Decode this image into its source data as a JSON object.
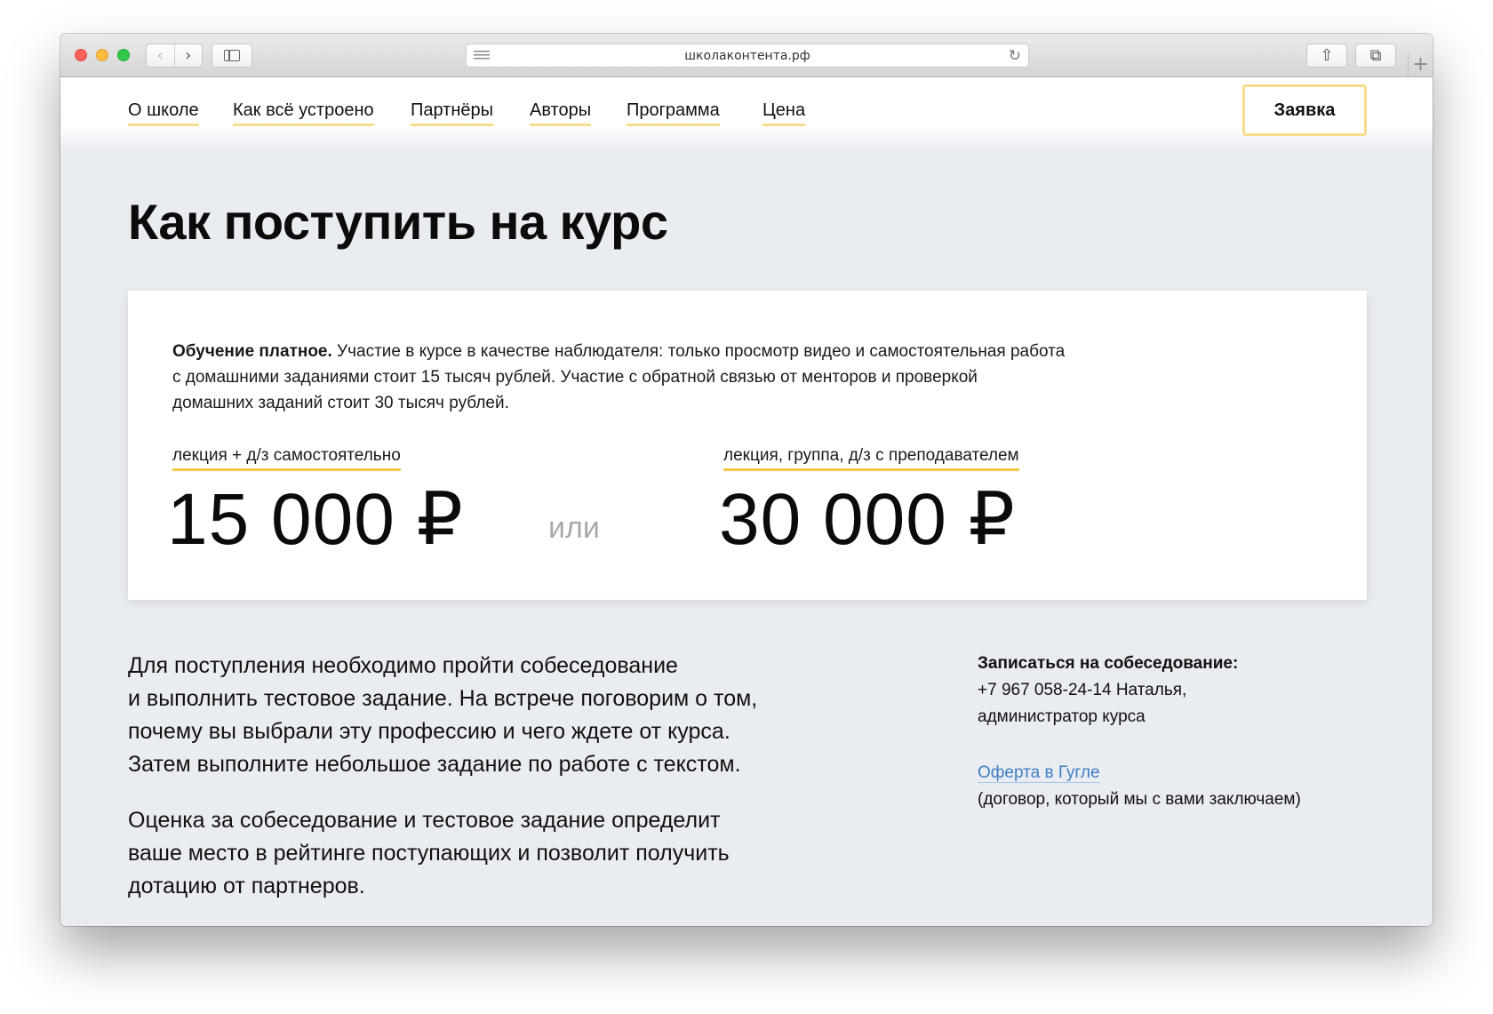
{
  "browser": {
    "url": "школаконтента.рф",
    "icons": [
      "back-icon",
      "forward-icon",
      "sidebar-icon",
      "reader-icon",
      "reload-icon",
      "share-icon",
      "tabs-icon",
      "new-tab-icon"
    ]
  },
  "nav": {
    "items": [
      "О школе",
      "Как всё устроено",
      "Партнёры",
      "Авторы",
      "Программа",
      "Цена"
    ],
    "apply_label": "Заявка"
  },
  "page": {
    "title": "Как поступить на курс"
  },
  "pricing": {
    "intro_bold": "Обучение платное.",
    "intro_line1": " Участие в курсе в качестве наблюдателя: только просмотр видео и самостоятельная работа",
    "intro_line2": "с домашними заданиями стоит 15 тысяч рублей. Участие с обратной связью от менторов и проверкой",
    "intro_line3": "домашних заданий стоит 30 тысяч рублей.",
    "plans": [
      {
        "label": "лекция + д/з самостоятельно",
        "price": "15 000 ₽"
      },
      {
        "label": "лекция, группа, д/з с преподавателем",
        "price": "30 000 ₽"
      }
    ],
    "or_text": "или"
  },
  "admission": {
    "para1": [
      "Для поступления необходимо пройти собеседование",
      "и выполнить тестовое задание. На встрече поговорим о том,",
      "почему вы выбрали эту профессию и чего ждете от курса.",
      "Затем выполните небольшое задание по работе с текстом."
    ],
    "para2": [
      "Оценка за собеседование и тестовое задание определит",
      "ваше место в рейтинге поступающих и позволит получить",
      "дотацию от партнеров."
    ]
  },
  "contact": {
    "heading": "Записаться на собеседование:",
    "phone_line": "+7 967 058-24-14 Наталья,",
    "role_line": "администратор курса",
    "offer_link": "Оферта в Гугле",
    "offer_note": "(договор, который мы с вами заключаем)"
  },
  "colors": {
    "accent_yellow": "#f5dd8b",
    "link_blue": "#3f7ec5",
    "page_bg": "#e9ecf1"
  }
}
